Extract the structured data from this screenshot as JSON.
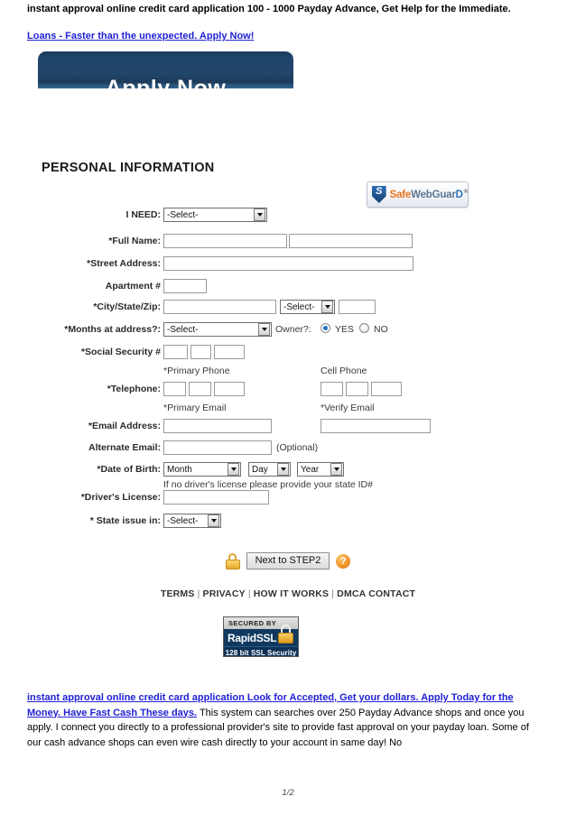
{
  "header": {
    "title": "instant approval online credit card application 100 - 1000 Payday Advance, Get Help for the Immediate.",
    "link": "Loans - Faster than the unexpected. Apply Now!"
  },
  "banner": {
    "label": "Apply Now"
  },
  "section": {
    "title": "PERSONAL INFORMATION"
  },
  "badge_swg": {
    "shield_letter": "S",
    "part1": "Safe",
    "part2": "WebGuar",
    "part3": "D",
    "registered": "®"
  },
  "form": {
    "i_need": {
      "label": "I NEED:",
      "value": "-Select-"
    },
    "full_name": {
      "label": "*Full Name:",
      "first_value": "",
      "last_value": "",
      "placeholder": ""
    },
    "street_address": {
      "label": "*Street Address:",
      "value": ""
    },
    "apartment": {
      "label": "Apartment #",
      "value": ""
    },
    "city_state_zip": {
      "label": "*City/State/Zip:",
      "city_value": "",
      "state_value": "-Select-",
      "zip_value": ""
    },
    "months_at_address": {
      "label": "*Months at address?:",
      "value": "-Select-",
      "owner_label": "Owner?:",
      "yes_label": "YES",
      "no_label": "NO",
      "selected": "YES"
    },
    "social_security": {
      "label": "*Social Security #",
      "p1": "",
      "p2": "",
      "p3": ""
    },
    "telephone": {
      "label": "*Telephone:",
      "primary_header": "*Primary Phone",
      "cell_header": "Cell Phone",
      "primary": {
        "area": "",
        "prefix": "",
        "line": ""
      },
      "cell": {
        "area": "",
        "prefix": "",
        "line": ""
      }
    },
    "email_address": {
      "label": "*Email Address:",
      "primary_header": "*Primary Email",
      "verify_header": "*Verify Email",
      "primary_value": "",
      "verify_value": ""
    },
    "alternate_email": {
      "label": "Alternate Email:",
      "value": "",
      "note": "(Optional)"
    },
    "date_of_birth": {
      "label": "*Date of Birth:",
      "month": "Month",
      "day": "Day",
      "year": "Year"
    },
    "drivers_license": {
      "label": "*Driver's License:",
      "hint": "If no driver's license please provide your state ID#",
      "value": ""
    },
    "state_issued": {
      "label": "* State issue in:",
      "value": "-Select-"
    }
  },
  "actions": {
    "next_button": "Next to STEP2",
    "lock_icon": "padlock-icon",
    "help_icon": "?"
  },
  "footer": {
    "links": [
      "TERMS",
      "PRIVACY",
      "HOW IT WORKS",
      "DMCA CONTACT"
    ],
    "separator": "|"
  },
  "badge_ssl": {
    "top": "SECURED BY",
    "name": "RapidSSL",
    "bottom": "128 bit SSL Security"
  },
  "bottom": {
    "link_text": "instant approval online credit card application Look for Accepted, Get your dollars. Apply Today for the Money. Have Fast Cash These days.",
    "body_text": " This system can searches over 250 Payday Advance shops and once you apply. I connect you directly to a professional provider's site to provide fast approval on your payday loan. Some of our cash advance shops can even wire cash directly to your account in same day! No"
  },
  "page_number": "1/2"
}
